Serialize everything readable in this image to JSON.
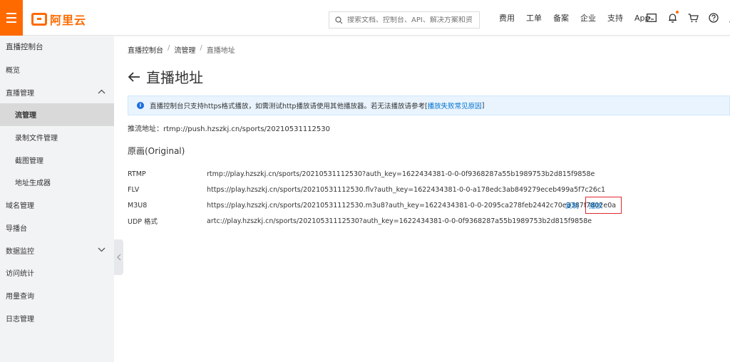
{
  "topbar": {
    "logo_text": "阿里云",
    "search_placeholder": "搜索文档、控制台、API、解决方案和资",
    "links": [
      "费用",
      "工单",
      "备案",
      "企业",
      "支持",
      "App"
    ],
    "icons": [
      "terminal-icon",
      "bell-icon",
      "cart-icon",
      "help-icon",
      "user-icon"
    ],
    "accent_color": "#ff6a00"
  },
  "sidebar": {
    "items": [
      {
        "label": "直播控制台",
        "level": "header"
      },
      {
        "label": "概览",
        "level": "top"
      },
      {
        "label": "直播管理",
        "level": "top",
        "expanded": true
      },
      {
        "label": "流管理",
        "level": "sub",
        "active": true
      },
      {
        "label": "录制文件管理",
        "level": "sub"
      },
      {
        "label": "截图管理",
        "level": "sub"
      },
      {
        "label": "地址生成器",
        "level": "sub"
      },
      {
        "label": "域名管理",
        "level": "top"
      },
      {
        "label": "导播台",
        "level": "top"
      },
      {
        "label": "数据监控",
        "level": "top",
        "expanded": false
      },
      {
        "label": "访问统计",
        "level": "top"
      },
      {
        "label": "用量查询",
        "level": "top"
      },
      {
        "label": "日志管理",
        "level": "top"
      }
    ]
  },
  "breadcrumb": [
    "直播控制台",
    "流管理",
    "直播地址"
  ],
  "page_title": "直播地址",
  "notice": {
    "text": "直播控制台只支持https格式播放，如需测试http播放请使用其他播放器。若无法播放请参考[",
    "link": "播放失败常见原因",
    "suffix": "]"
  },
  "push": {
    "label": "推流地址：",
    "url": "rtmp://push.hzszkj.cn/sports/20210531112530"
  },
  "section_title": "原画(Original)",
  "urls": [
    {
      "protocol": "RTMP",
      "url": "rtmp://play.hzszkj.cn/sports/20210531112530?auth_key=1622434381-0-0-0f9368287a55b1989753b2d815f9858e"
    },
    {
      "protocol": "FLV",
      "url": "https://play.hzszkj.cn/sports/20210531112530.flv?auth_key=1622434381-0-0-a178edc3ab849279eceb499a5f7c26c1"
    },
    {
      "protocol": "M3U8",
      "url": "https://play.hzszkj.cn/sports/20210531112530.m3u8?auth_key=1622434381-0-0-2095ca278feb2442c70e3387f7802e0a",
      "copy": "复制",
      "play": "播放"
    },
    {
      "protocol": "UDP 格式",
      "url": "artc://play.hzszkj.cn/sports/20210531112530?auth_key=1622434381-0-0-0f9368287a55b1989753b2d815f9858e"
    }
  ]
}
